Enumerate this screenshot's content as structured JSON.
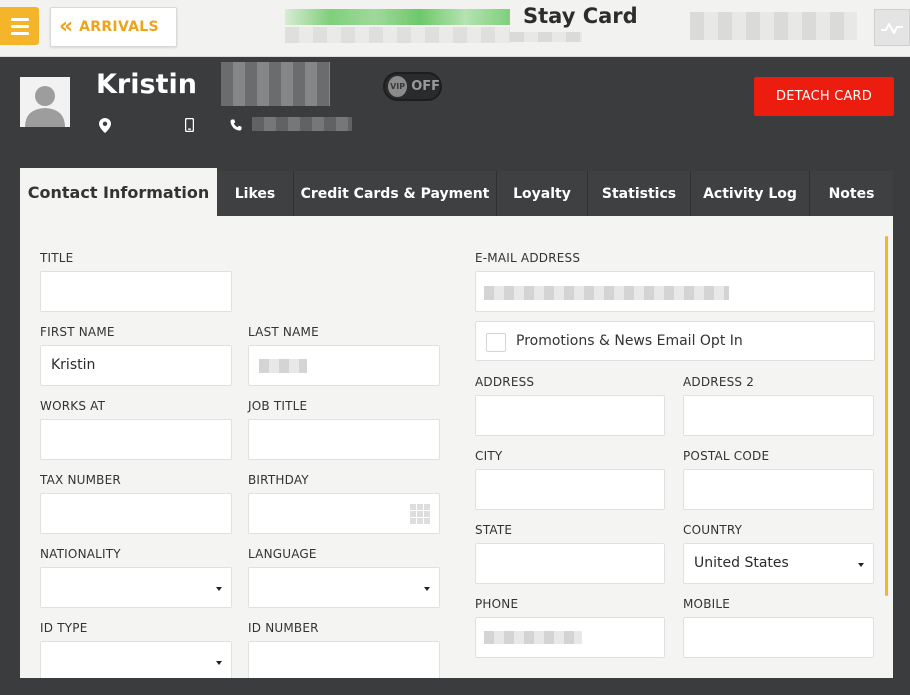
{
  "topbar": {
    "back_label": "ARRIVALS",
    "title": "Stay Card"
  },
  "guest": {
    "name": "Kristin",
    "vip_badge": "VIP",
    "vip_state": "OFF",
    "detach_label": "DETACH CARD"
  },
  "tabs": [
    {
      "label": "Contact Information"
    },
    {
      "label": "Likes"
    },
    {
      "label": "Credit Cards & Payment"
    },
    {
      "label": "Loyalty"
    },
    {
      "label": "Statistics"
    },
    {
      "label": "Activity Log"
    },
    {
      "label": "Notes"
    }
  ],
  "form": {
    "title": {
      "label": "TITLE",
      "value": ""
    },
    "first_name": {
      "label": "FIRST NAME",
      "value": "Kristin"
    },
    "last_name": {
      "label": "LAST NAME"
    },
    "works_at": {
      "label": "WORKS AT",
      "value": ""
    },
    "job_title": {
      "label": "JOB TITLE",
      "value": ""
    },
    "tax_number": {
      "label": "TAX NUMBER",
      "value": ""
    },
    "birthday": {
      "label": "BIRTHDAY",
      "value": ""
    },
    "nationality": {
      "label": "NATIONALITY",
      "value": ""
    },
    "language": {
      "label": "LANGUAGE",
      "value": ""
    },
    "id_type": {
      "label": "ID TYPE",
      "value": ""
    },
    "id_number": {
      "label": "ID NUMBER",
      "value": ""
    },
    "email": {
      "label": "E-MAIL ADDRESS"
    },
    "optin": {
      "label": "Promotions & News Email Opt In"
    },
    "address": {
      "label": "ADDRESS",
      "value": ""
    },
    "address2": {
      "label": "ADDRESS 2",
      "value": ""
    },
    "city": {
      "label": "CITY",
      "value": ""
    },
    "postal_code": {
      "label": "POSTAL CODE",
      "value": ""
    },
    "state": {
      "label": "STATE",
      "value": ""
    },
    "country": {
      "label": "COUNTRY",
      "value": "United States"
    },
    "phone": {
      "label": "PHONE"
    },
    "mobile": {
      "label": "MOBILE",
      "value": ""
    }
  },
  "colors": {
    "accent": "#f4b52a",
    "detach": "#ec1c0e",
    "header_bg": "#3b3c3e",
    "arrivals_text": "#f0a319"
  },
  "icons": [
    "menu-icon",
    "double-chevron-left-icon",
    "activity-icon",
    "avatar-icon",
    "location-icon",
    "mobile-icon",
    "phone-icon",
    "calendar-icon",
    "dropdown-caret-icon"
  ]
}
